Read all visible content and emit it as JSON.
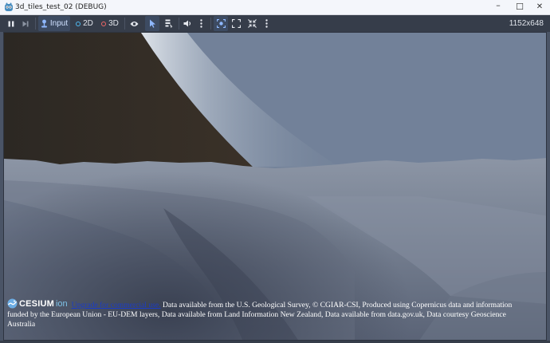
{
  "window": {
    "title": "3d_tiles_test_02 (DEBUG)",
    "minimize_symbol": "–",
    "maximize_symbol": "☐",
    "close_symbol": "✕"
  },
  "toolbar": {
    "pause_icon": "pause-icon",
    "step_icon": "step-frame-icon",
    "input_label": "Input",
    "mode_2d_label": "2D",
    "mode_3d_label": "3D",
    "mode_2d_color": "#4fb9f0",
    "mode_3d_color": "#f06666",
    "visibility_icon": "eye-icon",
    "select_icon": "cursor-icon",
    "list_icon": "list-icon",
    "audio_icon": "speaker-icon",
    "camera_override_icon": "camera-override-icon",
    "fit_icon": "fit-view-icon",
    "embed_icon": "embed-window-icon",
    "resolution": "1152x648"
  },
  "viewport": {
    "sky_top_color": "#7c8ba1",
    "terrain_color": "#7d8799"
  },
  "credits": {
    "logo_text": "CESIUM",
    "logo_suffix": "ion",
    "link_text": "Upgrade for commercial use.",
    "attribution": "Data available from the U.S. Geological Survey, © CGIAR-CSI, Produced using Copernicus data and information funded by the European Union - EU-DEM layers, Data available from Land Information New Zealand, Data available from data.gov.uk, Data courtesy Geoscience Australia"
  }
}
